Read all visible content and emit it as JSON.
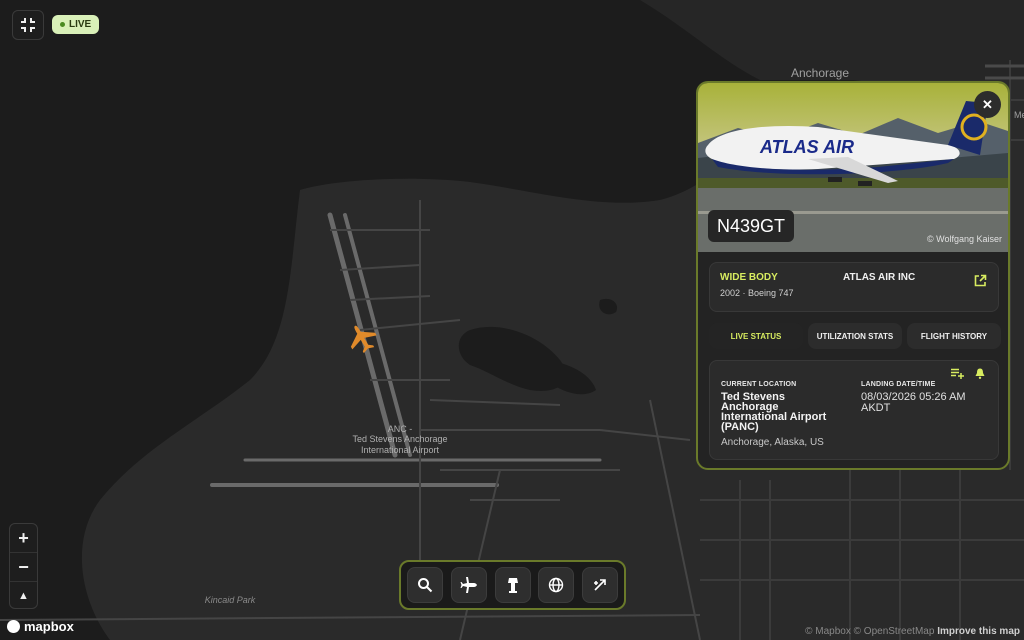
{
  "map": {
    "city_label": "Anchorage",
    "airport_label_line1": "ANC -",
    "airport_label_line2": "Ted Stevens Anchorage",
    "airport_label_line3": "International Airport",
    "park_label": "Kincaid Park",
    "edge_label": "Me"
  },
  "live_badge": {
    "label": "LIVE"
  },
  "zoom": {
    "in_label": "+",
    "out_label": "−",
    "compass_label": "▲"
  },
  "mapbox_logo": {
    "label": "mapbox"
  },
  "attribution": {
    "mapbox": "© Mapbox",
    "osm": "© OpenStreetMap",
    "improve": "Improve this map"
  },
  "aircraft_card": {
    "registration": "N439GT",
    "photo_credit": "© Wolfgang Kaiser",
    "photo_livery": "ATLAS AIR",
    "category": "WIDE BODY",
    "year_model": "2002 · Boeing 747",
    "operator": "ATLAS AIR INC",
    "tabs": [
      {
        "label": "LIVE STATUS",
        "active": true
      },
      {
        "label": "UTILIZATION STATS",
        "active": false
      },
      {
        "label": "FLIGHT HISTORY",
        "active": false
      }
    ],
    "current_location_label": "CURRENT LOCATION",
    "location_line1": "Ted Stevens",
    "location_line2": "Anchorage",
    "location_line3": "International Airport",
    "location_line4": "(PANC)",
    "location_region": "Anchorage, Alaska, US",
    "landing_label": "LANDING DATE/TIME",
    "landing_line1": "08/03/2026 05:26 AM",
    "landing_line2": "AKDT"
  },
  "toolbar": {
    "buttons": [
      {
        "icon": "search-icon"
      },
      {
        "icon": "airplane-icon"
      },
      {
        "icon": "control-tower-icon"
      },
      {
        "icon": "globe-icon"
      },
      {
        "icon": "flight-route-icon"
      }
    ]
  },
  "colors": {
    "accent": "#d8ec60",
    "border_accent": "#6a7a2a",
    "aircraft_marker": "#e08a2a",
    "map_bg": "#1c1c1c",
    "land": "#2b2b2b"
  }
}
